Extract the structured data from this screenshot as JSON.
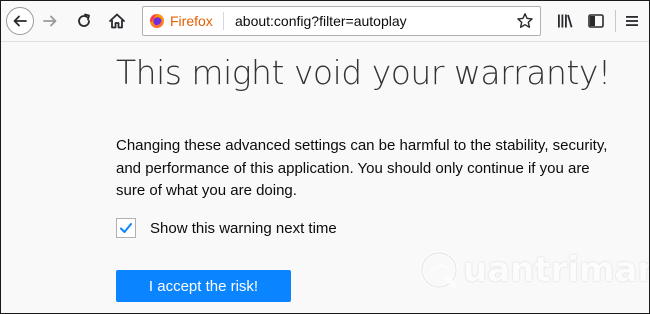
{
  "toolbar": {
    "back_icon": "arrow-left-icon",
    "forward_icon": "arrow-right-icon",
    "reload_icon": "reload-icon",
    "home_icon": "home-icon",
    "library_icon": "library-icon",
    "sidebar_icon": "sidebar-icon",
    "menu_icon": "hamburger-menu-icon"
  },
  "urlbar": {
    "identity_label": "Firefox",
    "identity_icon": "firefox-logo-icon",
    "url": "about:config?filter=autoplay",
    "bookmark_icon": "star-icon"
  },
  "warning": {
    "title": "This might void your warranty!",
    "description": "Changing these advanced settings can be harmful to the stability, security, and performance of this application. You should only continue if you are sure of what you are doing.",
    "checkbox_label": "Show this warning next time",
    "checkbox_checked": true,
    "accept_button": "I accept the risk!"
  },
  "watermark": {
    "text": "uantrimang",
    "logo": "quantrimang-logo"
  },
  "colors": {
    "accent": "#0a84ff",
    "firefox_label": "#e66000",
    "background": "#f9f9fa"
  }
}
